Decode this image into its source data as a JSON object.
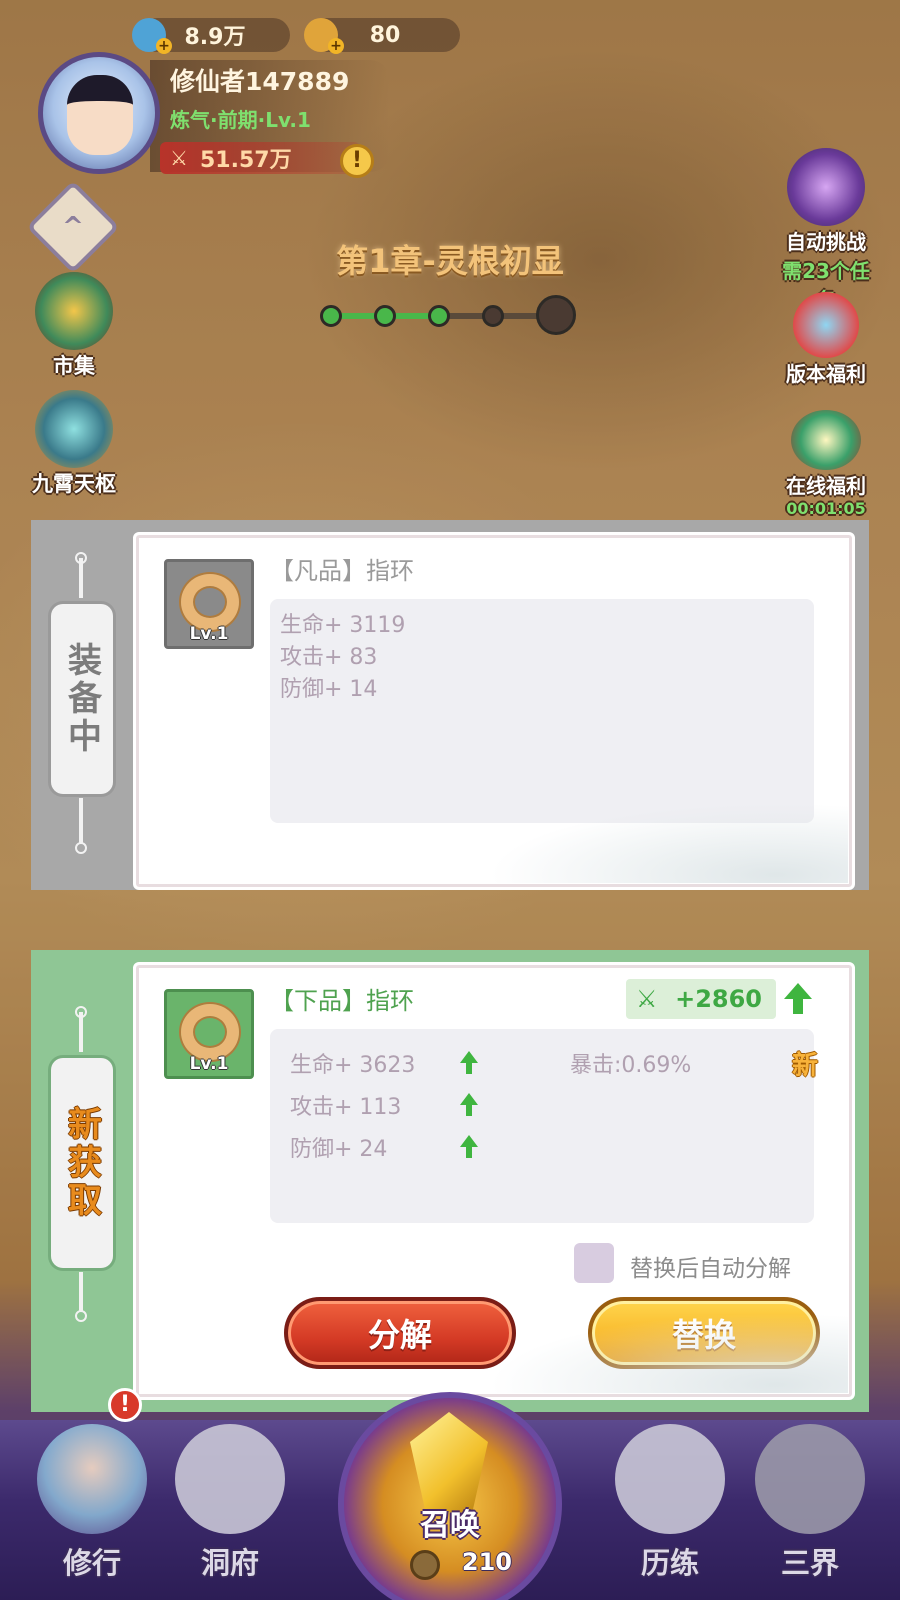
{
  "hud": {
    "currency1_value": "8.9万",
    "currency2_value": "80",
    "player_name": "修仙者147889",
    "player_realm": "炼气·前期·Lv.1",
    "combat_power": "51.57万",
    "alert_symbol": "!"
  },
  "left_menu": [
    {
      "label": "市集",
      "icon": "pavilion-icon"
    },
    {
      "label": "九霄天枢",
      "icon": "compass-icon"
    }
  ],
  "right_menu": [
    {
      "label": "自动挑战",
      "sub": "需23个任务",
      "icon": "dragon-icon"
    },
    {
      "label": "版本福利",
      "icon": "koi-icon"
    },
    {
      "label": "在线福利",
      "sub": "00:01:05",
      "icon": "gift-icon"
    }
  ],
  "chapter": {
    "title": "第1章-灵根初显",
    "stages_total": 5,
    "stages_cleared": 3
  },
  "equipped": {
    "tag": "装备中",
    "item_name": "【凡品】指环",
    "level": "Lv.1",
    "stats": [
      "生命+ 3119",
      "攻击+ 83",
      "防御+ 14"
    ]
  },
  "new_item": {
    "tag": "新获取",
    "item_name": "【下品】指环",
    "level": "Lv.1",
    "power_delta": "+2860",
    "stats": [
      "生命+ 3623",
      "攻击+ 113",
      "防御+ 24"
    ],
    "extra_stat": "暴击:0.69%",
    "new_badge": "新",
    "auto_decompose_label": "替换后自动分解",
    "auto_decompose_checked": false,
    "decompose_button": "分解",
    "replace_button": "替换"
  },
  "bottom_nav": {
    "items": [
      "修行",
      "洞府",
      "召唤",
      "历练",
      "三界"
    ],
    "summon_cost": "210",
    "badge": "!"
  },
  "colors": {
    "equipped_bg": "#a8a8a8",
    "new_bg": "#8fc695",
    "stat_up": "#3fb53f",
    "decompose": "#d43a25",
    "replace": "#f8b72a"
  }
}
